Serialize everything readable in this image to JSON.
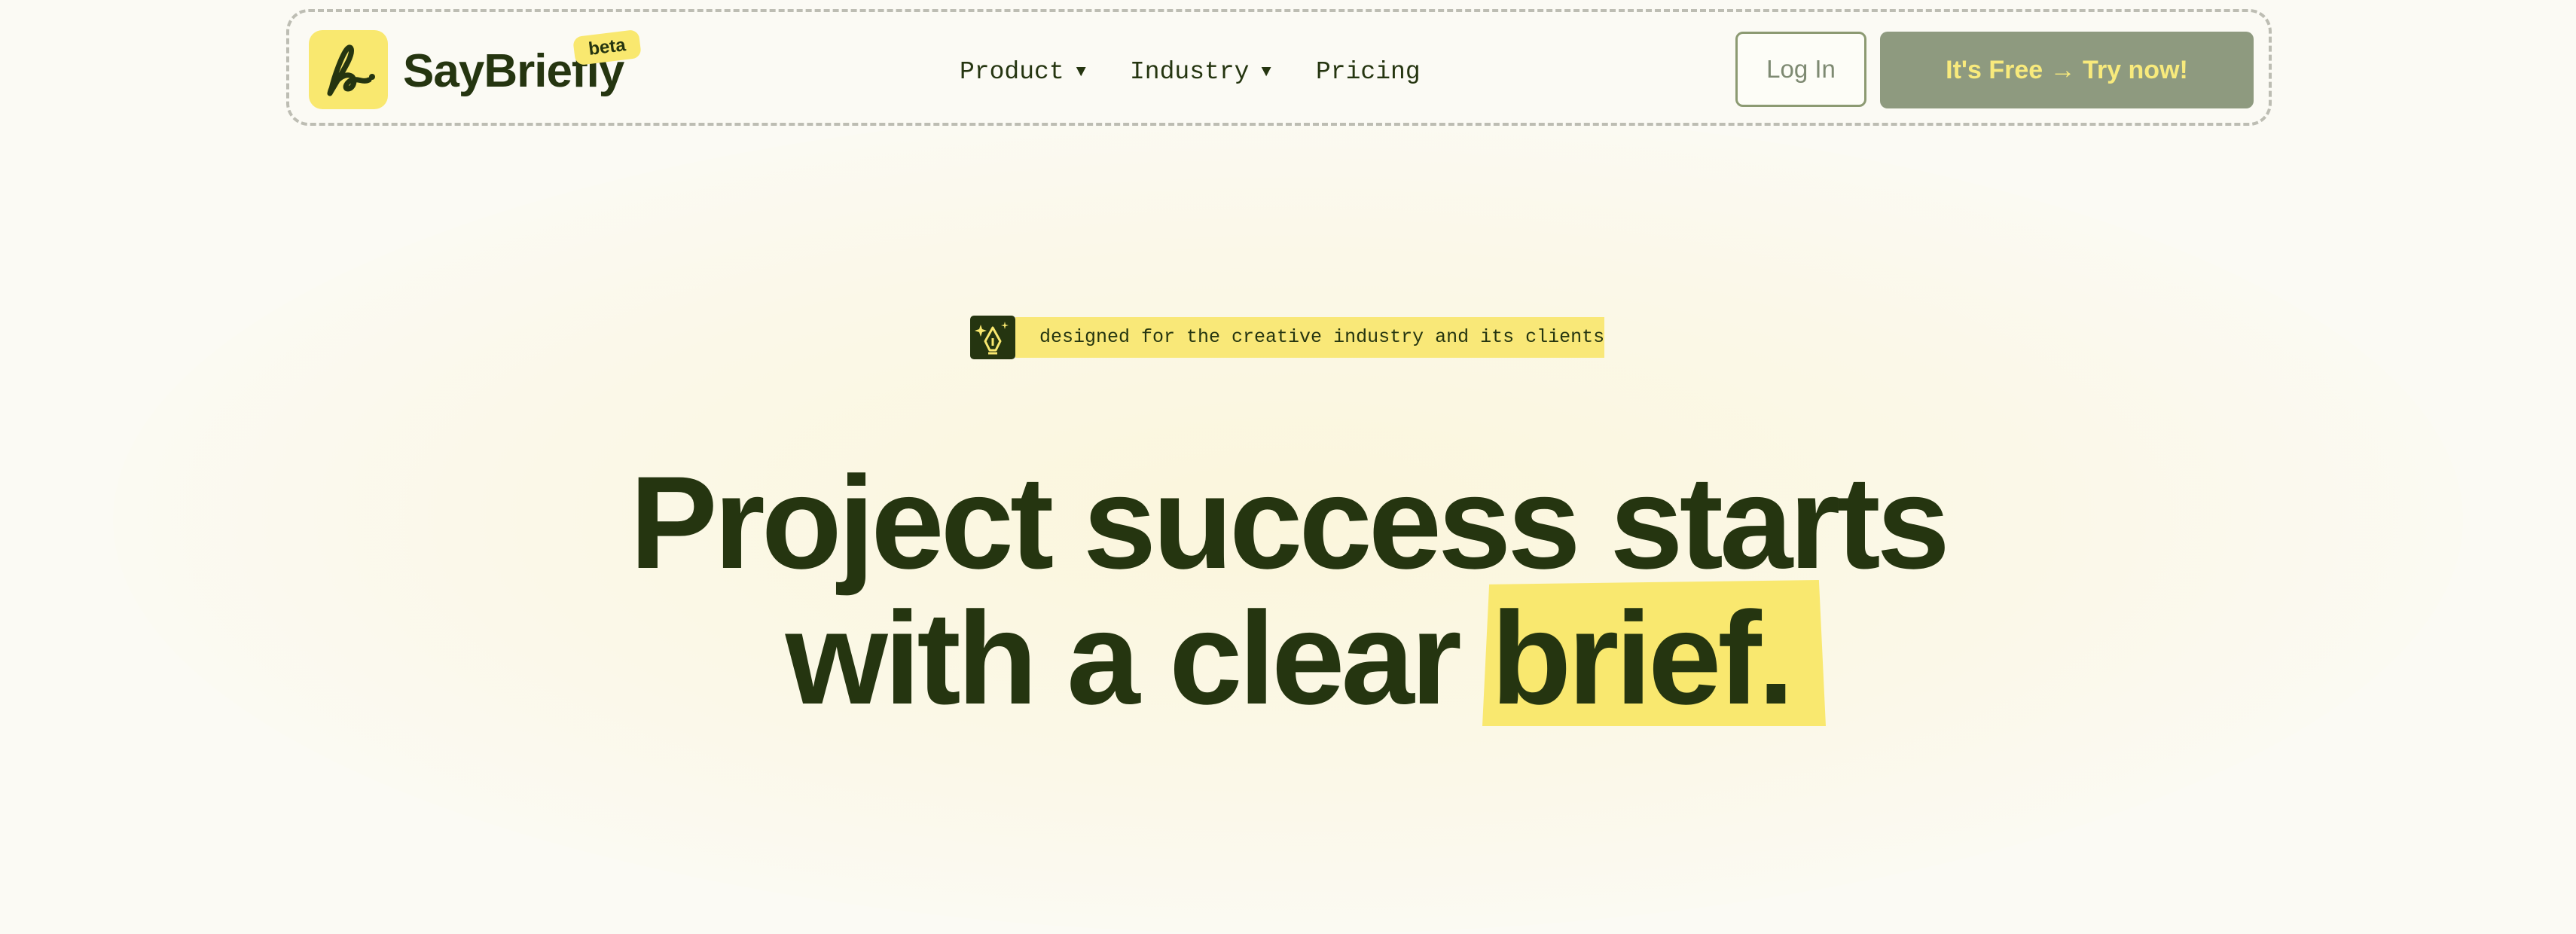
{
  "brand": {
    "name": "SayBriefly",
    "badge": "beta",
    "logo_icon": "signature-logo-icon"
  },
  "nav": {
    "items": [
      {
        "label": "Product",
        "has_dropdown": true
      },
      {
        "label": "Industry",
        "has_dropdown": true
      },
      {
        "label": "Pricing",
        "has_dropdown": false
      }
    ],
    "caret": "▼",
    "login_label": "Log In",
    "cta_label": "It's Free → Try now!"
  },
  "hero": {
    "tagline": "designed for the creative industry and its clients",
    "tagline_icon": "pen-nib-sparkle-icon",
    "headline_line1": "Project success starts",
    "headline_line2_prefix": "with a clear",
    "headline_highlight": "brief."
  },
  "colors": {
    "background": "#fbfaf4",
    "ink": "#253510",
    "accent_yellow": "#f9e86f",
    "cta_bg": "#8e9a7f",
    "cta_text": "#f8ea7c"
  }
}
